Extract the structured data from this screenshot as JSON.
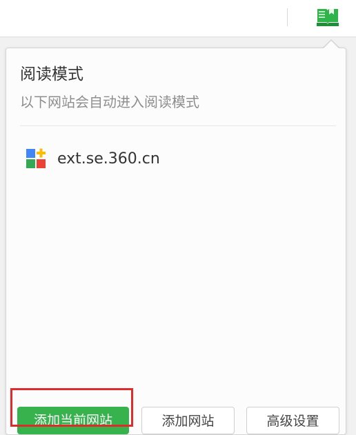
{
  "toolbar": {
    "reader_icon": "book-reader-icon",
    "accent": "#2fb44b"
  },
  "popup": {
    "title": "阅读模式",
    "subtitle": "以下网站会自动进入阅读模式",
    "sites": [
      {
        "url": "ext.se.360.cn",
        "icon": "app-grid-plus-icon"
      }
    ],
    "buttons": {
      "add_current": "添加当前网站",
      "add": "添加网站",
      "settings": "高级设置"
    }
  },
  "colors": {
    "primary_button": "#37b24d",
    "highlight": "#e02b2b",
    "icon_blue": "#4285f4",
    "icon_orange": "#fbbc05",
    "icon_green": "#34a853",
    "icon_red": "#ea4335"
  }
}
